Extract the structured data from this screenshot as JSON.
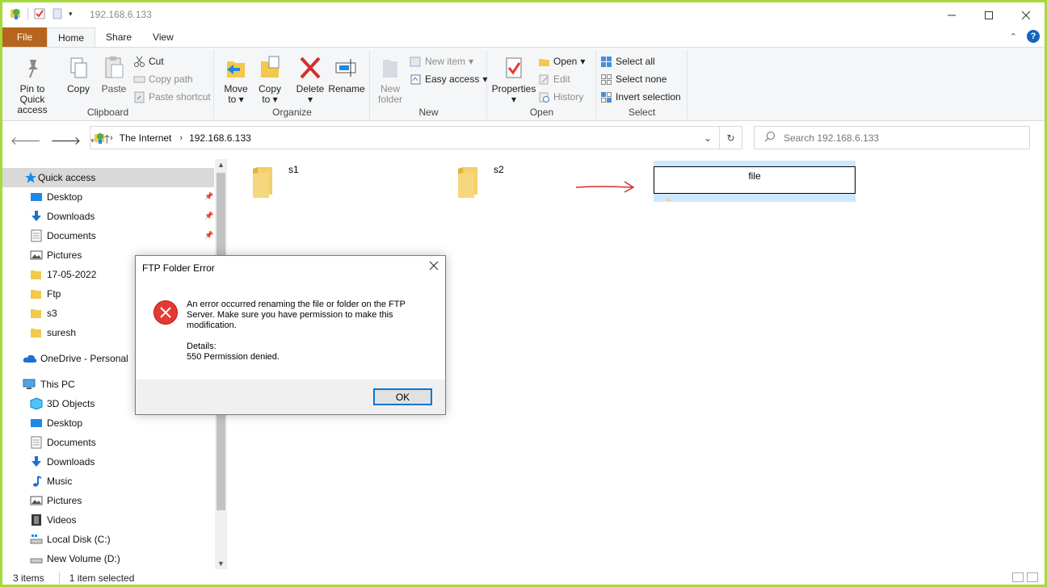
{
  "window": {
    "title": "192.168.6.133"
  },
  "tabs": [
    {
      "label": "File"
    },
    {
      "label": "Home"
    },
    {
      "label": "Share"
    },
    {
      "label": "View"
    }
  ],
  "ribbon": {
    "clipboard": {
      "label": "Clipboard",
      "pin_line1": "Pin to Quick",
      "pin_line2": "access",
      "copy": "Copy",
      "paste": "Paste",
      "cut": "Cut",
      "copy_path": "Copy path",
      "paste_shortcut": "Paste shortcut"
    },
    "organize": {
      "label": "Organize",
      "move": "Move",
      "move2": "to",
      "copy": "Copy",
      "copy2": "to",
      "delete": "Delete",
      "rename": "Rename"
    },
    "new": {
      "label": "New",
      "new_folder1": "New",
      "new_folder2": "folder",
      "new_item": "New item",
      "easy_access": "Easy access"
    },
    "open": {
      "label": "Open",
      "properties": "Properties",
      "open": "Open",
      "edit": "Edit",
      "history": "History"
    },
    "select": {
      "label": "Select",
      "select_all": "Select all",
      "select_none": "Select none",
      "invert": "Invert selection"
    }
  },
  "address": {
    "segments": [
      "The Internet",
      "192.168.6.133"
    ]
  },
  "search": {
    "placeholder": "Search 192.168.6.133"
  },
  "nav": {
    "quick_access": "Quick access",
    "quick_items": [
      {
        "label": "Desktop"
      },
      {
        "label": "Downloads"
      },
      {
        "label": "Documents"
      },
      {
        "label": "Pictures"
      },
      {
        "label": "17-05-2022"
      },
      {
        "label": "Ftp"
      },
      {
        "label": "s3"
      },
      {
        "label": "suresh"
      }
    ],
    "onedrive": "OneDrive - Personal",
    "this_pc": "This PC",
    "pc_items": [
      {
        "label": "3D Objects"
      },
      {
        "label": "Desktop"
      },
      {
        "label": "Documents"
      },
      {
        "label": "Downloads"
      },
      {
        "label": "Music"
      },
      {
        "label": "Pictures"
      },
      {
        "label": "Videos"
      },
      {
        "label": "Local Disk (C:)"
      },
      {
        "label": "New Volume (D:)"
      }
    ]
  },
  "files": [
    {
      "name": "s1"
    },
    {
      "name": "s2"
    },
    {
      "name": "file"
    }
  ],
  "status": {
    "count": "3 items",
    "selected": "1 item selected"
  },
  "dialog": {
    "title": "FTP Folder Error",
    "message": "An error occurred renaming the file or folder on the FTP Server.  Make sure you have permission to make this modification.",
    "details_label": "Details:",
    "details": "550 Permission denied.",
    "ok": "OK"
  },
  "colors": {
    "accent": "#0078d7",
    "file_tab": "#b5651d",
    "border": "#a6d93c",
    "error": "#e53935",
    "annotation_arrow": "#d32f2f"
  }
}
